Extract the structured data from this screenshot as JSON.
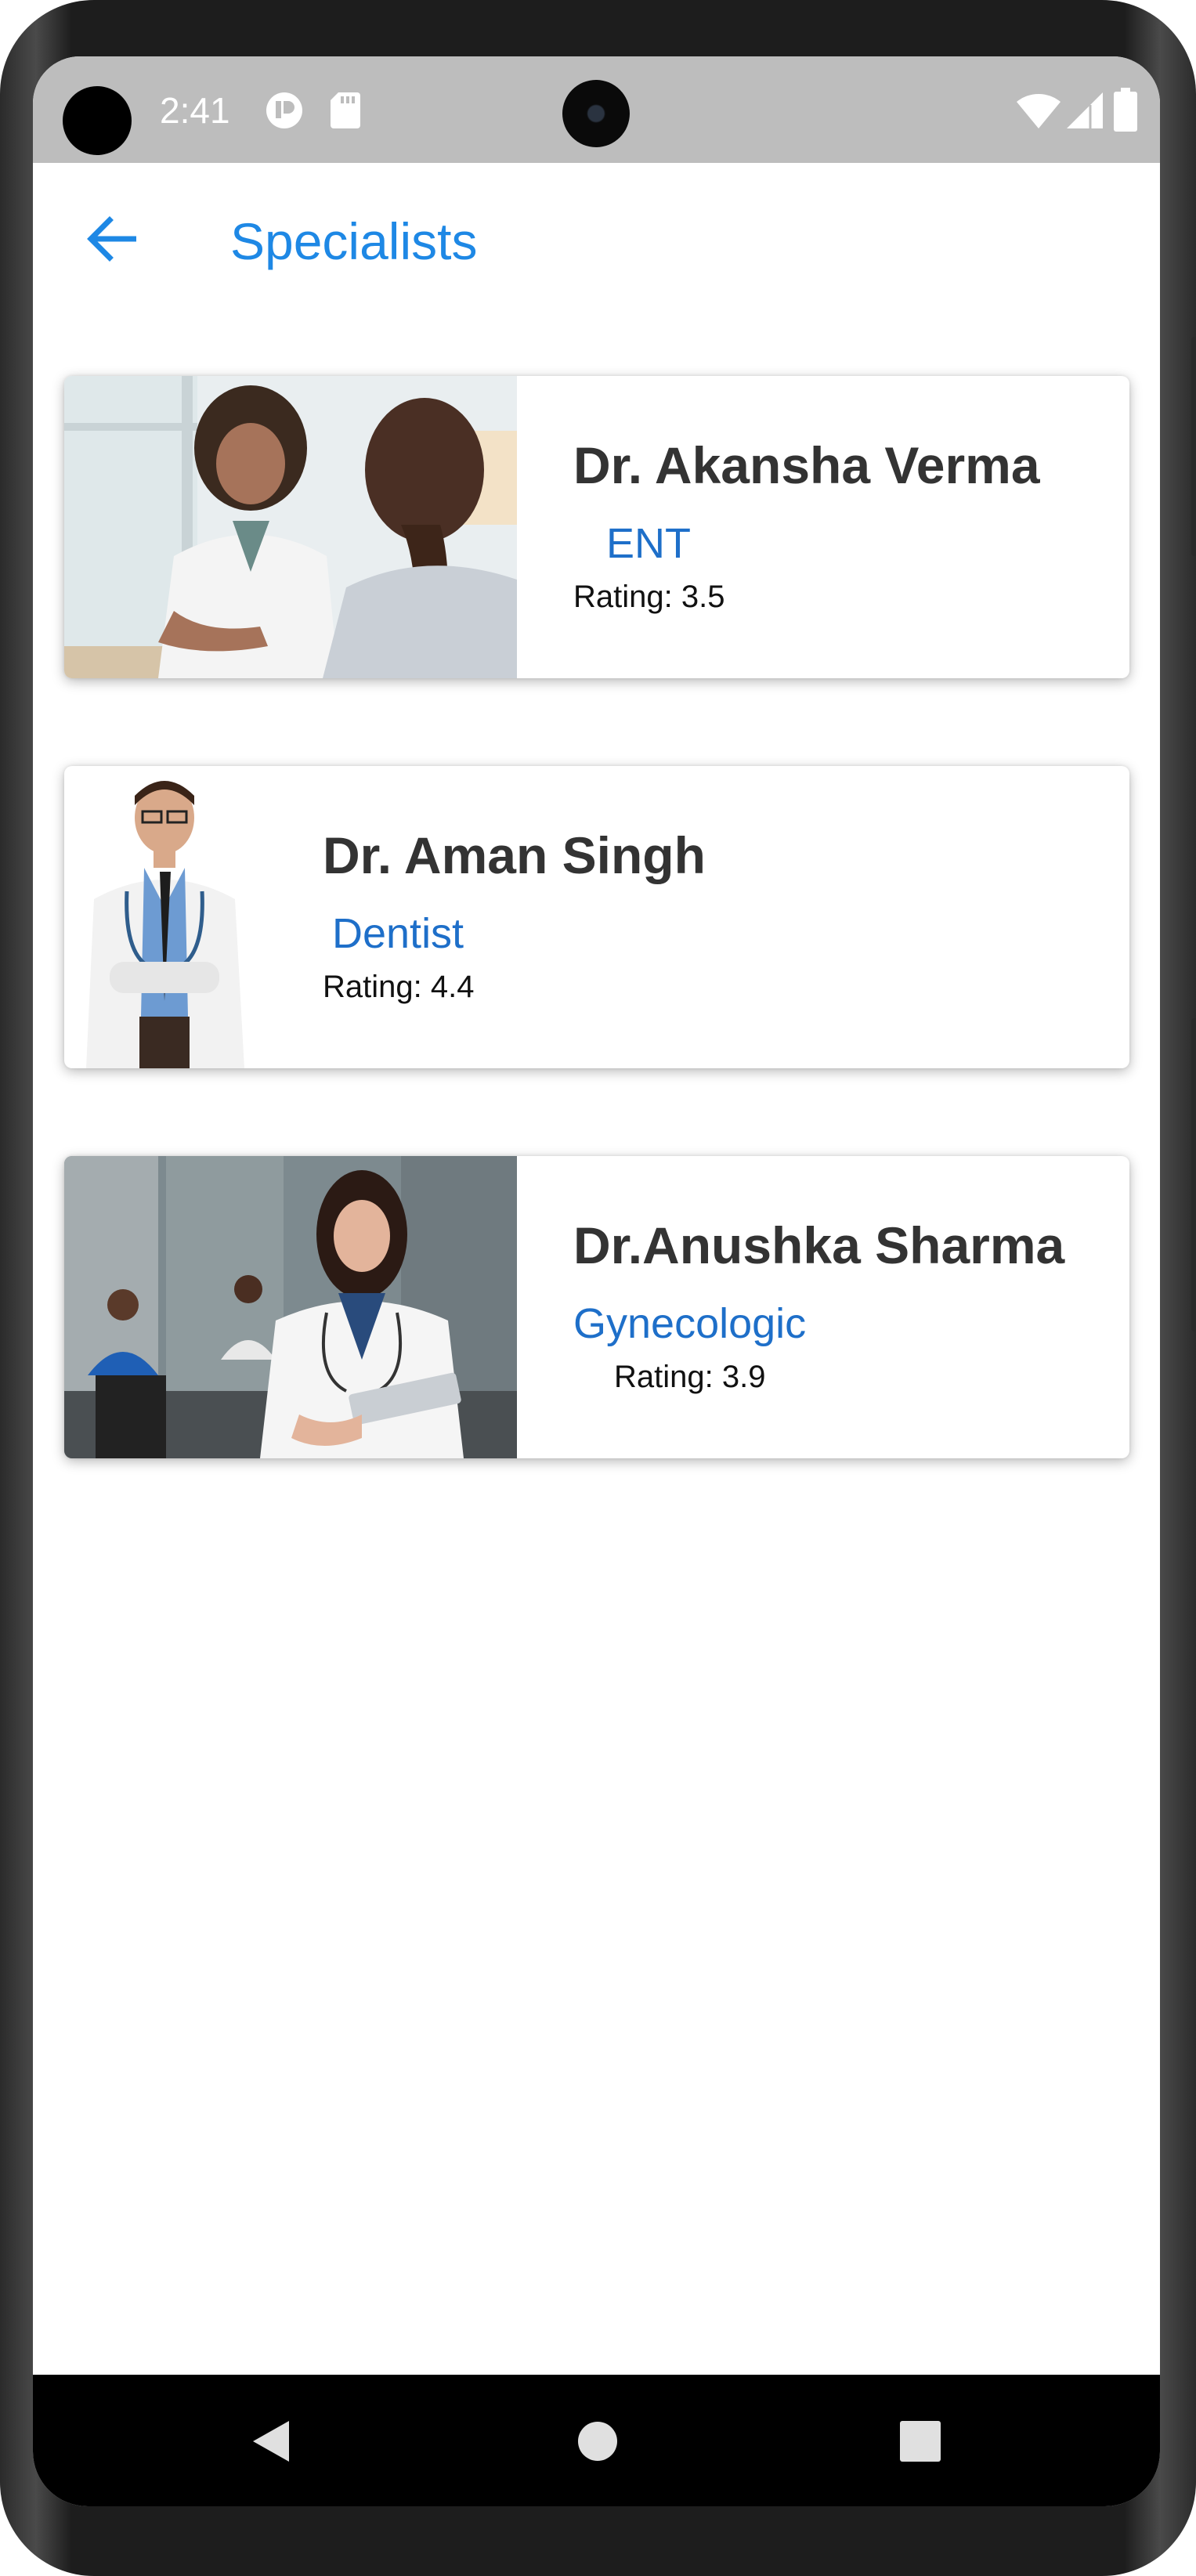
{
  "status_bar": {
    "time": "2:41",
    "icons": [
      "notification-icon",
      "sd-card-icon",
      "wifi-icon",
      "signal-icon",
      "battery-icon"
    ]
  },
  "app_bar": {
    "title": "Specialists",
    "back_icon": "arrow-back-icon"
  },
  "doctors": [
    {
      "name": "Dr. Akansha Verma",
      "specialty": "ENT",
      "rating": "Rating: 3.5",
      "photo": "doctor-consultation-photo"
    },
    {
      "name": "Dr. Aman Singh",
      "specialty": "Dentist",
      "rating": "Rating: 4.4",
      "photo": "male-doctor-portrait-photo"
    },
    {
      "name": "Dr.Anushka Sharma",
      "specialty": "Gynecologic",
      "rating": "Rating: 3.9",
      "photo": "female-doctor-tablet-photo"
    }
  ],
  "nav_bar": {
    "icons": [
      "back-nav-icon",
      "home-nav-icon",
      "recents-nav-icon"
    ]
  },
  "colors": {
    "accent": "#1e88e5",
    "specialty": "#1e6fc9",
    "status_bar": "#bdbdbd",
    "name_text": "#333333"
  }
}
